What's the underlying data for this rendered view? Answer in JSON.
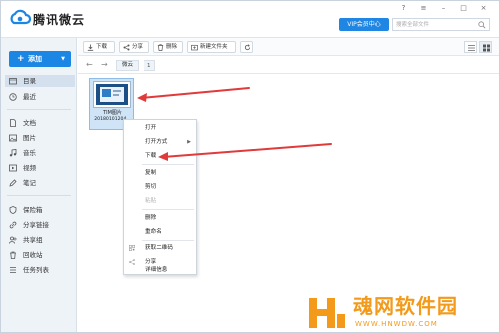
{
  "app": {
    "brand": "腾讯微云",
    "vip_label": "VIP会员中心",
    "search_placeholder": "搜索全部文件",
    "window_controls": [
      "?",
      "≡",
      "–",
      "□",
      "×"
    ]
  },
  "sidebar": {
    "add_label": "添加",
    "items": [
      {
        "label": "目录",
        "icon": "folder-icon",
        "active": true
      },
      {
        "label": "最近",
        "icon": "clock-icon",
        "active": false
      },
      {
        "label": "文档",
        "icon": "document-icon",
        "active": false
      },
      {
        "label": "图片",
        "icon": "image-icon",
        "active": false
      },
      {
        "label": "音乐",
        "icon": "music-icon",
        "active": false
      },
      {
        "label": "视频",
        "icon": "video-icon",
        "active": false
      },
      {
        "label": "笔记",
        "icon": "note-icon",
        "active": false
      },
      {
        "label": "保险箱",
        "icon": "safe-icon",
        "active": false
      },
      {
        "label": "分享链接",
        "icon": "link-icon",
        "active": false
      },
      {
        "label": "共享组",
        "icon": "group-icon",
        "active": false
      },
      {
        "label": "回收站",
        "icon": "trash-icon",
        "active": false
      },
      {
        "label": "任务列表",
        "icon": "task-list-icon",
        "active": false
      }
    ]
  },
  "toolbar": {
    "download_label": "下载",
    "share_label": "分享",
    "delete_label": "删除",
    "new_folder_label": "新建文件夹"
  },
  "breadcrumb": {
    "path": "微云",
    "count": "1"
  },
  "file": {
    "name": "TIM图片",
    "date": "20180101204..."
  },
  "context_menu": {
    "items": [
      {
        "label": "打开"
      },
      {
        "label": "打开方式"
      },
      {
        "label": "下载"
      },
      {
        "label": "复制"
      },
      {
        "label": "剪切"
      },
      {
        "label": "粘贴"
      },
      {
        "label": "删除"
      },
      {
        "label": "重命名"
      },
      {
        "label": "获取二维码"
      },
      {
        "label": "分享"
      },
      {
        "label": "详细信息"
      }
    ]
  },
  "watermark": {
    "title": "魂网软件园",
    "url": "WWW.HNWDW.COM"
  },
  "colors": {
    "accent": "#1b86e4",
    "annotation_arrow": "#e03a3a",
    "watermark": "#f39a1a"
  }
}
